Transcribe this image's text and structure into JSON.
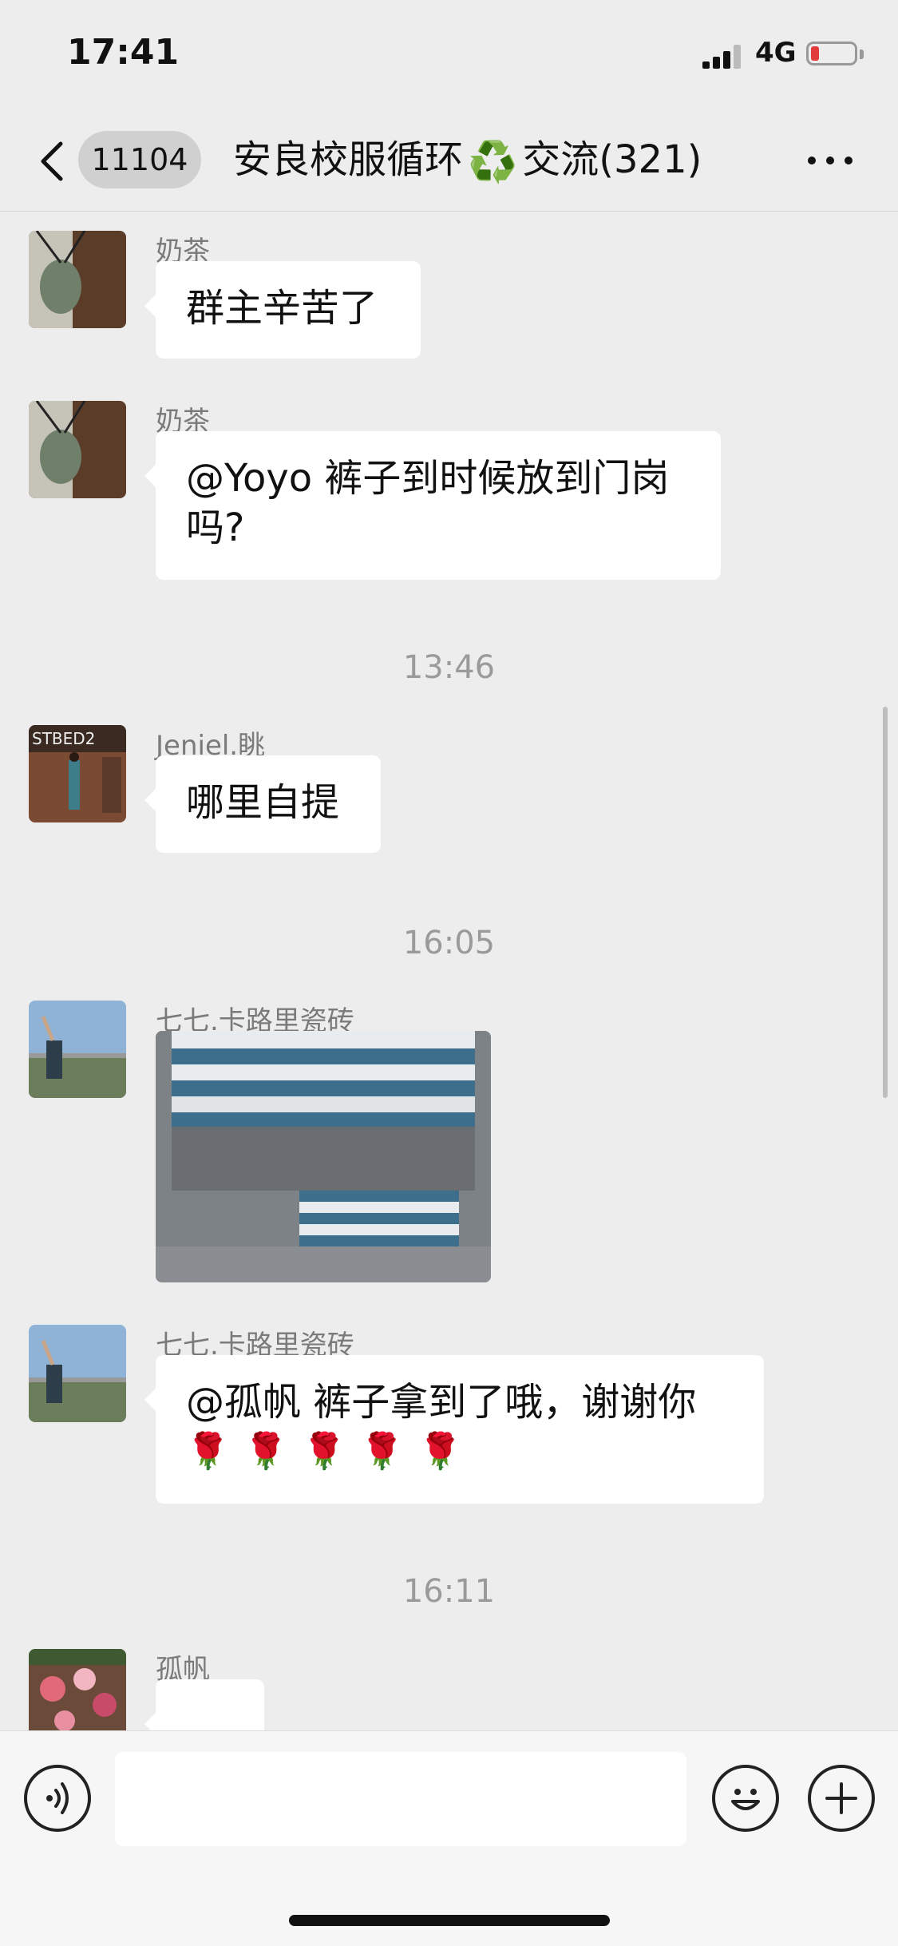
{
  "status_bar": {
    "time": "17:41",
    "network": "4G",
    "battery_color": "#e23b3b"
  },
  "header": {
    "group_badge": "11104",
    "title_part1": "安良校服循环",
    "recycle_symbol": "♻️",
    "title_part2": "交流(321)"
  },
  "messages": [
    {
      "sender": "奶茶",
      "text": "群主辛苦了"
    },
    {
      "sender": "奶茶",
      "text": "@Yoyo 裤子到时候放到门岗吗?"
    },
    {
      "timestamp": "13:46"
    },
    {
      "sender": "Jeniel.眺",
      "text": "哪里自提"
    },
    {
      "timestamp": "16:05"
    },
    {
      "sender": "七七.卡路里瓷砖",
      "image": "striped-pants-photo"
    },
    {
      "sender": "七七.卡路里瓷砖",
      "text": "@孤帆 裤子拿到了哦，谢谢你",
      "roses": "🌹🌹🌹🌹🌹"
    },
    {
      "timestamp": "16:11"
    },
    {
      "sender": "孤帆"
    }
  ],
  "input": {
    "placeholder": ""
  },
  "colors": {
    "background": "#ededed",
    "bubble": "#ffffff",
    "accent_green": "#1aad19"
  }
}
